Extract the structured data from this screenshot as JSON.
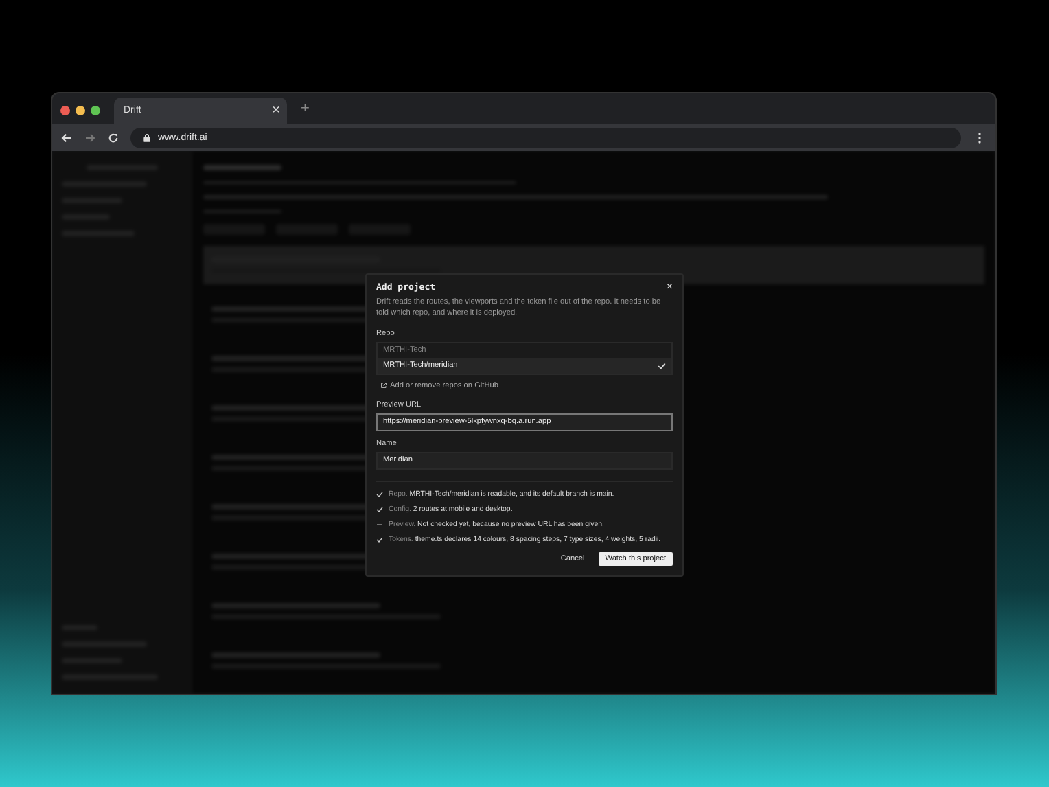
{
  "browser": {
    "tab_title": "Drift",
    "tab_close": "×",
    "new_tab": "+",
    "url": "www.drift.ai"
  },
  "dialog": {
    "title": "Add project",
    "close": "×",
    "description": "Drift reads the routes, the viewports and the token file out of the repo. It needs to be told which repo, and where it is deployed.",
    "repo_label": "Repo",
    "repo_options": [
      {
        "label": "MRTHI-Tech",
        "selected": false
      },
      {
        "label": "MRTHI-Tech/meridian",
        "selected": true
      }
    ],
    "repo_link": "Add or remove repos on GitHub",
    "preview_label": "Preview URL",
    "preview_value": "https://meridian-preview-5lkpfywnxq-bq.a.run.app",
    "preview_focused": true,
    "name_label": "Name",
    "name_value": "Meridian",
    "checks": [
      {
        "label": "Repo.",
        "text": "MRTHI-Tech/meridian is readable, and its default branch is main.",
        "checked": true
      },
      {
        "label": "Config.",
        "text": "2 routes at mobile and desktop.",
        "checked": true
      },
      {
        "label": "Preview.",
        "text": "Not checked yet, because no preview URL has been given.",
        "checked": false
      },
      {
        "label": "Tokens.",
        "text": "theme.ts declares 14 colours, 8 spacing steps, 7 type sizes, 4 weights, 5 radii.",
        "checked": true
      }
    ],
    "cancel": "Cancel",
    "confirm": "Watch this project"
  }
}
